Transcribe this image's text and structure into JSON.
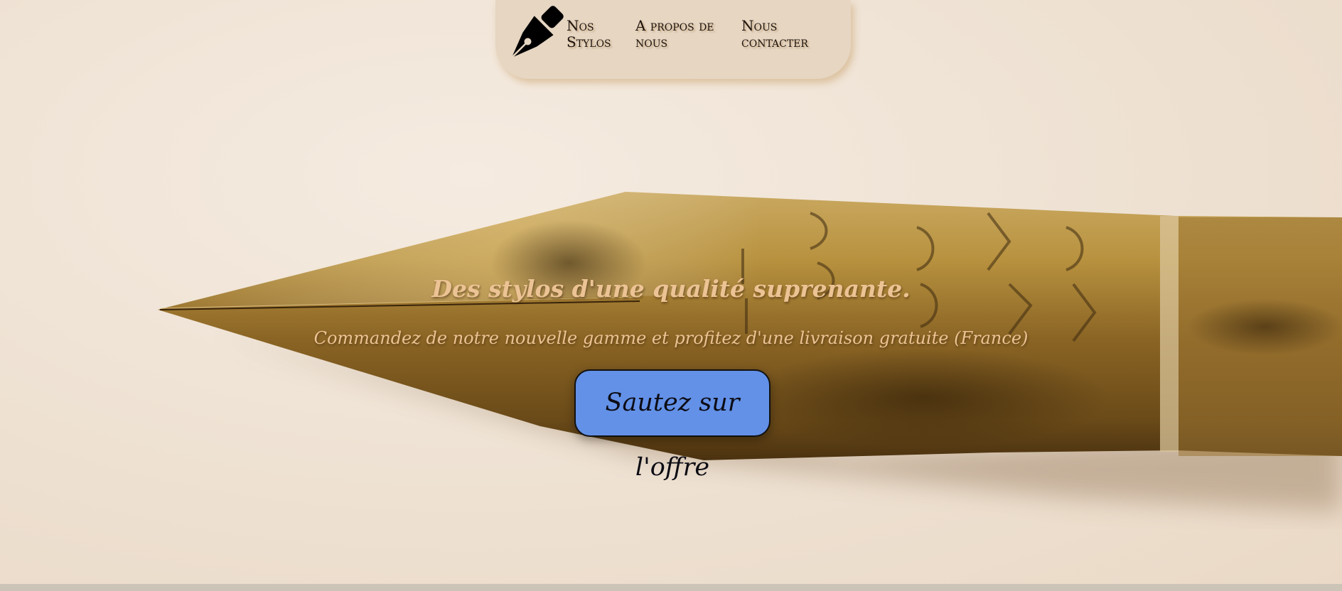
{
  "nav": {
    "logo_icon": "fountain-pen-nib-icon",
    "items": [
      {
        "label": "Nos Stylos"
      },
      {
        "label": "A propos de nous"
      },
      {
        "label": "Nous contacter"
      }
    ]
  },
  "hero": {
    "headline": "Des stylos d'une qualité suprenante.",
    "subheadline": "Commandez de notre nouvelle gamme et profitez d'une livraison gratuite (France)",
    "cta_label": "Sautez sur l'offre",
    "image_subject": "vintage-brass-fountain-pen-nib"
  },
  "colors": {
    "page_background": "#efe3d6",
    "navbar_background": "#e6d6c2",
    "headline_text": "#ecc394",
    "cta_background": "#6391e8",
    "nib_brass": "#a5802e",
    "footer_bar": "#cdc4b8"
  }
}
